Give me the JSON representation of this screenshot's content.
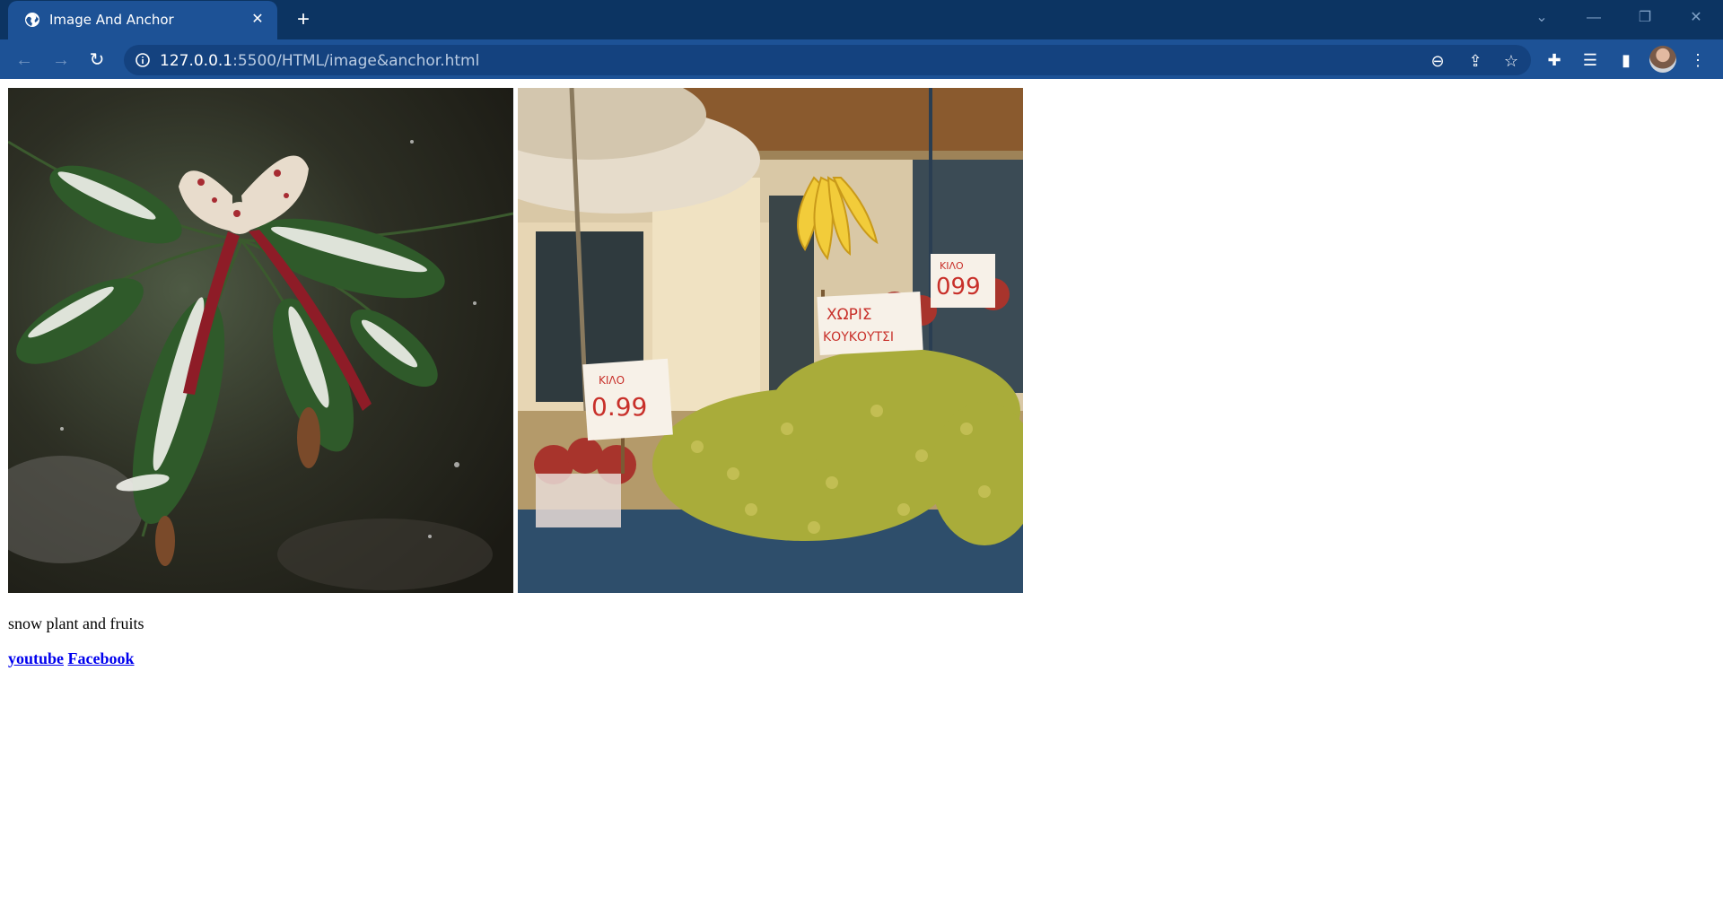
{
  "browser": {
    "tab_title": "Image And Anchor",
    "tab_close_icon": "close-icon",
    "new_tab_icon": "plus-icon",
    "url_host": "127.0.0.1",
    "url_path": ":5500/HTML/image&anchor.html",
    "window_controls": [
      "tab-search-icon",
      "minimize-icon",
      "restore-icon",
      "close-icon"
    ],
    "toolbar_icons": [
      "zoom-out-icon",
      "share-icon",
      "bookmark-star-icon",
      "extensions-puzzle-icon",
      "reading-list-icon",
      "side-panel-icon",
      "profile-avatar",
      "menu-kebab-icon"
    ]
  },
  "page": {
    "caption": "snow plant and fruits",
    "links": [
      {
        "label": "youtube"
      },
      {
        "label": "Facebook"
      }
    ]
  },
  "images": [
    {
      "name": "snowy-pine-branch-with-bow"
    },
    {
      "name": "fruit-market-stall"
    }
  ],
  "market_signs": {
    "sign1_line1": "ΧΩΡΙΣ",
    "sign1_line2": "ΚΟΥΚΟΥΤΣΙ",
    "sign2_line1": "ΚΙΛΟ",
    "sign2_price": "099",
    "sign3_line1": "ΚΙΛΟ",
    "sign3_price": "0.99"
  },
  "colors": {
    "titlebar": "#0c3462",
    "toolbar": "#1d5296",
    "link": "#0000ee"
  }
}
